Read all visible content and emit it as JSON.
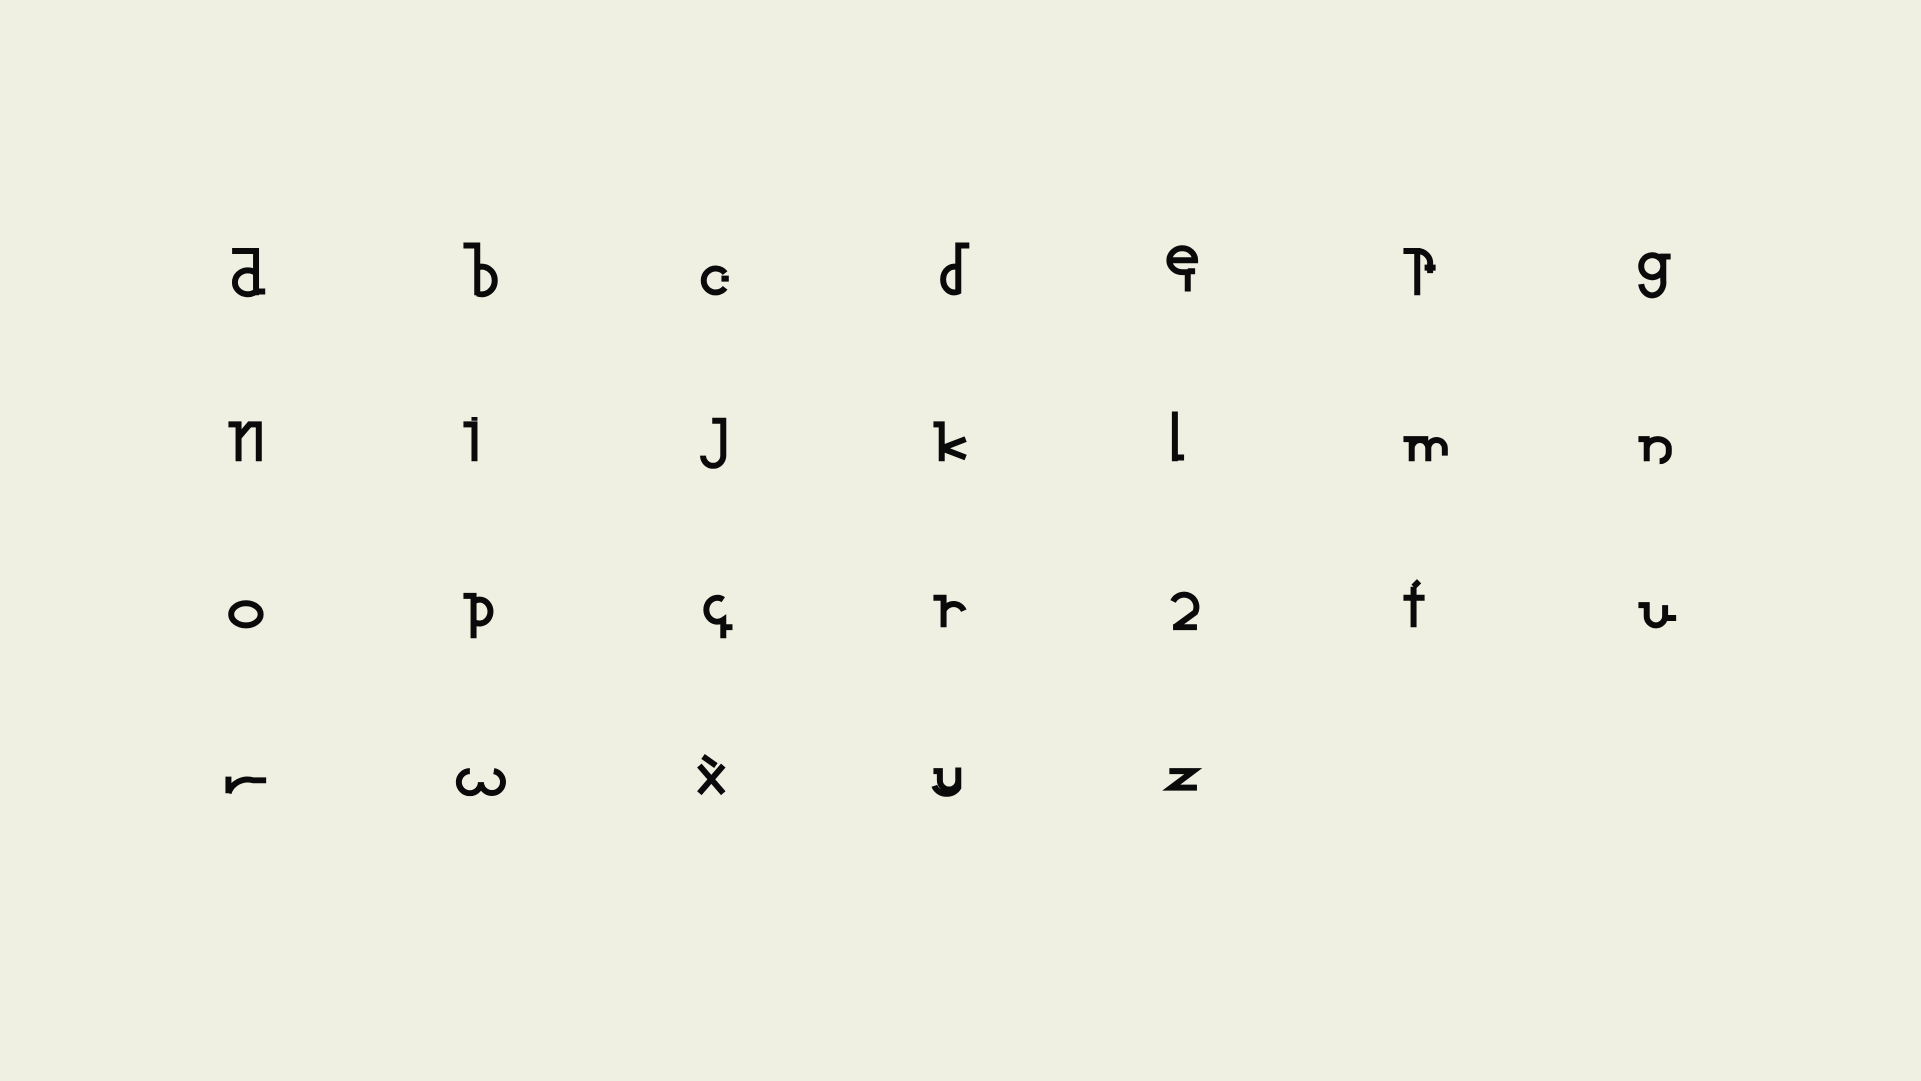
{
  "background_color": "#efefe2",
  "ink_color": "#0a0a0a",
  "specimen": {
    "glyphs": [
      "a",
      "b",
      "c",
      "d",
      "e",
      "f",
      "g",
      "h",
      "i",
      "j",
      "k",
      "l",
      "m",
      "n",
      "o",
      "p",
      "q",
      "r",
      "s",
      "t",
      "u",
      "v",
      "w",
      "x",
      "y",
      "z"
    ],
    "columns": 7
  }
}
